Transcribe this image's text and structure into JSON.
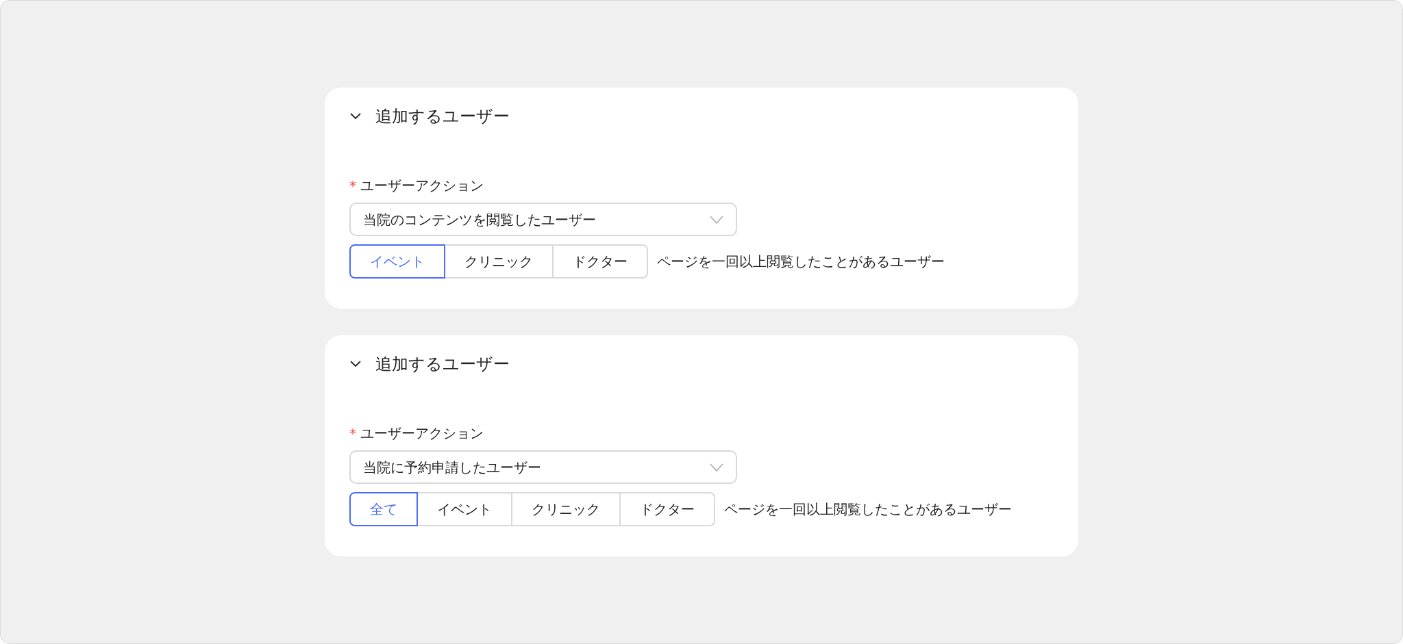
{
  "sections": [
    {
      "title": "追加するユーザー",
      "expanded": true,
      "field_label": "ユーザーアクション",
      "required_mark": "*",
      "select_value": "当院のコンテンツを閲覧したユーザー",
      "segments": [
        {
          "label": "イベント",
          "selected": true
        },
        {
          "label": "クリニック",
          "selected": false
        },
        {
          "label": "ドクター",
          "selected": false
        }
      ],
      "description": "ページを一回以上閲覧したことがあるユーザー"
    },
    {
      "title": "追加するユーザー",
      "expanded": true,
      "field_label": "ユーザーアクション",
      "required_mark": "*",
      "select_value": "当院に予約申請したユーザー",
      "segments": [
        {
          "label": "全て",
          "selected": true
        },
        {
          "label": "イベント",
          "selected": false
        },
        {
          "label": "クリニック",
          "selected": false
        },
        {
          "label": "ドクター",
          "selected": false
        }
      ],
      "description": "ページを一回以上閲覧したことがあるユーザー"
    }
  ]
}
